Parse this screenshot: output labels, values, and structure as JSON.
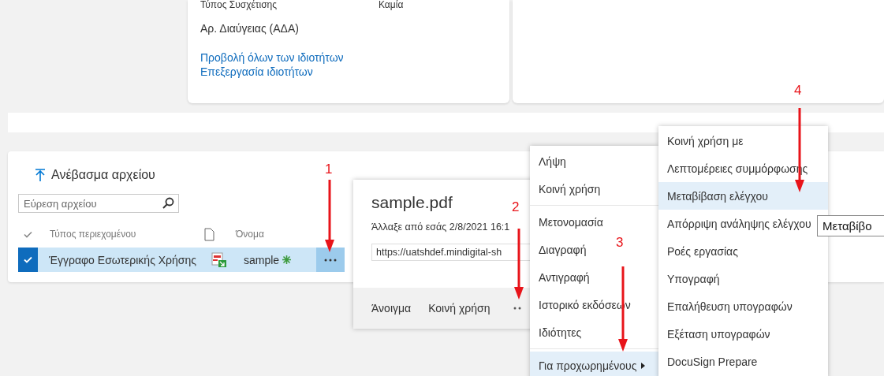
{
  "details_card": {
    "rows": [
      {
        "label": "Τύπος Συσχέτισης",
        "value": "Καμία"
      },
      {
        "label": "Αρ. Διαύγειας (ΑΔΑ)"
      }
    ],
    "links": [
      "Προβολή όλων των ιδιοτήτων",
      "Επεξεργασία ιδιοτήτων"
    ]
  },
  "library": {
    "upload": "Ανέβασμα αρχείου",
    "search": {
      "placeholder": "Εύρεση αρχείου"
    },
    "columns": [
      "Τύπος περιεχομένου",
      "Όνομα"
    ],
    "rows": [
      {
        "selected": true,
        "content_type": "Έγγραφο Εσωτερικής Χρήσης",
        "name": "sample"
      }
    ]
  },
  "callout": {
    "title": "sample.pdf",
    "modified": "Άλλαξε από εσάς 2/8/2021 16:1",
    "url": "https://uatshdef.mindigital-sh",
    "actions": [
      "Άνοιγμα",
      "Κοινή χρήση"
    ]
  },
  "context_menu": {
    "groups": [
      [
        {
          "label": "Λήψη",
          "selected": false,
          "submenu": false
        },
        {
          "label": "Κοινή χρήση",
          "selected": false,
          "submenu": false
        }
      ],
      [
        {
          "label": "Μετονομασία",
          "selected": false,
          "submenu": false
        },
        {
          "label": "Διαγραφή",
          "selected": false,
          "submenu": false
        },
        {
          "label": "Αντιγραφή",
          "selected": false,
          "submenu": false
        },
        {
          "label": "Ιστορικό εκδόσεων",
          "selected": false,
          "submenu": false
        },
        {
          "label": "Ιδιότητες",
          "selected": false,
          "submenu": false
        }
      ],
      [
        {
          "label": "Για προχωρημένους",
          "selected": true,
          "submenu": true
        }
      ]
    ]
  },
  "submenu": {
    "items": [
      {
        "label": "Κοινή χρήση με",
        "selected": false
      },
      {
        "label": "Λεπτομέρειες συμμόρφωσης",
        "selected": false
      },
      {
        "label": "Μεταβίβαση ελέγχου",
        "selected": true
      },
      {
        "label": "Απόρριψη ανάληψης ελέγχου",
        "selected": false
      },
      {
        "label": "Ροές εργασίας",
        "selected": false
      },
      {
        "label": "Υπογραφή",
        "selected": false
      },
      {
        "label": "Επαλήθευση υπογραφών",
        "selected": false
      },
      {
        "label": "Εξέταση υπογραφών",
        "selected": false
      },
      {
        "label": "DocuSign Prepare",
        "selected": false
      }
    ]
  },
  "tooltip": "Μεταβίβο",
  "annotations": [
    {
      "label": "1"
    },
    {
      "label": "2"
    },
    {
      "label": "3"
    },
    {
      "label": "4"
    }
  ]
}
